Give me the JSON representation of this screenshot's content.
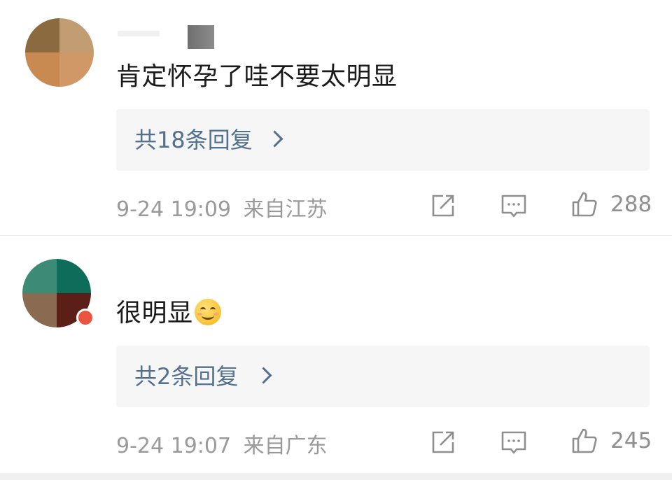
{
  "comments": [
    {
      "text": "肯定怀孕了哇不要太明显",
      "replies_label": "共18条回复",
      "time": "9-24 19:09",
      "location": "来自江苏",
      "likes": "288"
    },
    {
      "text": "很明显",
      "emoji": "smiling-face",
      "replies_label": "共2条回复",
      "time": "9-24 19:07",
      "location": "来自广东",
      "likes": "245"
    }
  ],
  "icons": {
    "share": "share-icon",
    "comment": "comment-icon",
    "like": "thumbs-up-icon"
  },
  "colors": {
    "reply_link": "#53718f",
    "meta_text": "#9a9a9a",
    "reply_bg": "#f6f6f6"
  }
}
